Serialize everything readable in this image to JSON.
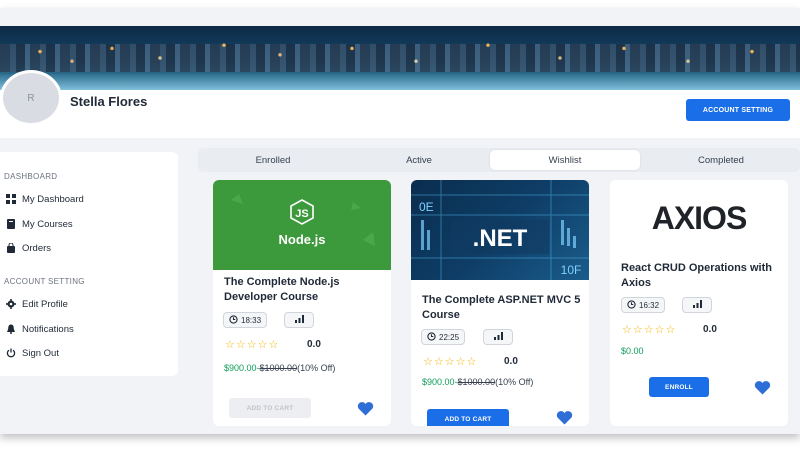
{
  "profile": {
    "avatar_initial": "R",
    "name": "Stella Flores",
    "account_button": "ACCOUNT SETTING"
  },
  "sidebar": {
    "dashboard_heading": "DASHBOARD",
    "items_dashboard": [
      {
        "label": "My Dashboard",
        "icon": "dashboard-icon"
      },
      {
        "label": "My Courses",
        "icon": "book-icon"
      },
      {
        "label": "Orders",
        "icon": "bag-icon"
      }
    ],
    "account_heading": "ACCOUNT SETTING",
    "items_account": [
      {
        "label": "Edit Profile",
        "icon": "gear-icon"
      },
      {
        "label": "Notifications",
        "icon": "bell-icon"
      },
      {
        "label": "Sign Out",
        "icon": "power-icon"
      }
    ]
  },
  "tabs": [
    {
      "label": "Enrolled"
    },
    {
      "label": "Active"
    },
    {
      "label": "Wishlist"
    },
    {
      "label": "Completed"
    }
  ],
  "active_tab": "Wishlist",
  "cards": [
    {
      "thumb_text": "Node.js",
      "title": "The Complete Node.js Developer Course",
      "duration": "18:33",
      "rating": "0.0",
      "price_now": "$900.00-",
      "price_old": "$1000.00",
      "discount": "(10% Off)",
      "button": "ADD TO CART"
    },
    {
      "thumb_text": ".NET",
      "thumb_sub": "0E",
      "title": "The Complete ASP.NET MVC 5 Course",
      "duration": "22:25",
      "rating": "0.0",
      "price_now": "$900.00-",
      "price_old": "$1000.00",
      "discount": "(10% Off)",
      "button": "ADD TO CART"
    },
    {
      "thumb_text": "AXIOS",
      "title": "React CRUD Operations with Axios",
      "duration": "16:32",
      "rating": "0.0",
      "price": "$0.00",
      "button": "ENROLL"
    }
  ],
  "colors": {
    "accent": "#1a6ee8",
    "price_green": "#0f9d58",
    "star": "#f5b301",
    "node_green": "#3c9a3c",
    "net_blue": "#0e3d66"
  }
}
